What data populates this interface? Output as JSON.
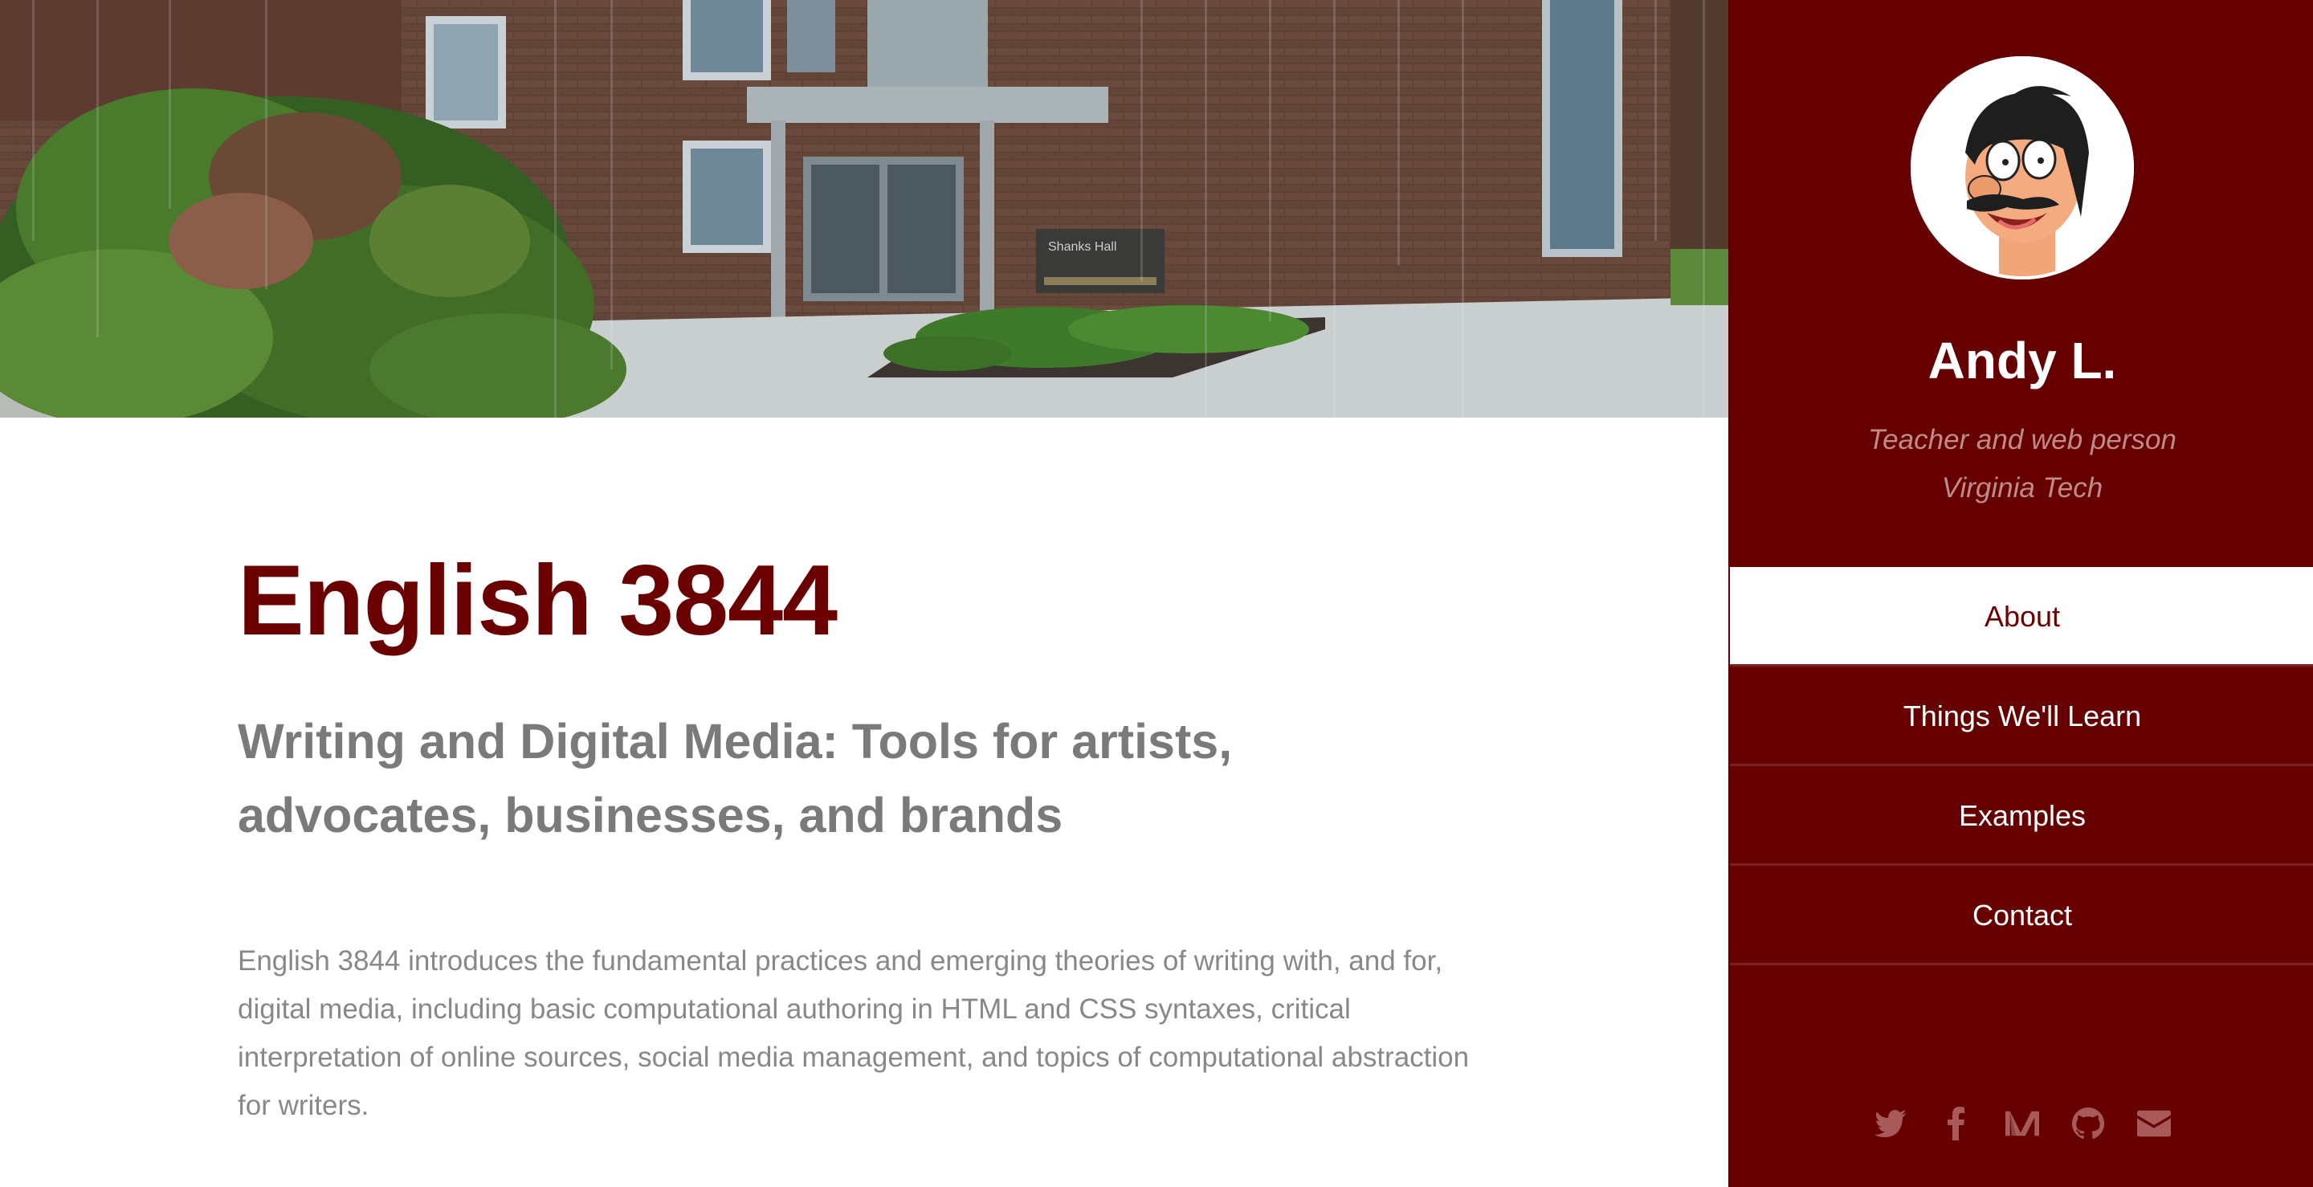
{
  "main": {
    "title": "English 3844",
    "subtitle": "Writing and Digital Media: Tools for artists, advocates, businesses, and brands",
    "description": "English 3844 introduces the fundamental practices and emerging theories of writing with, and for, digital media, including basic computational authoring in HTML and CSS syntaxes, critical interpretation of online sources, social media management, and topics of computational abstraction for writers.",
    "hero_sign_text": "Shanks Hall"
  },
  "sidebar": {
    "name": "Andy L.",
    "role": "Teacher and web person",
    "organization": "Virginia Tech",
    "nav": [
      {
        "label": "About",
        "active": true
      },
      {
        "label": "Things We'll Learn",
        "active": false
      },
      {
        "label": "Examples",
        "active": false
      },
      {
        "label": "Contact",
        "active": false
      }
    ],
    "social": [
      "twitter-icon",
      "facebook-icon",
      "medium-icon",
      "github-icon",
      "email-icon"
    ]
  },
  "colors": {
    "maroon": "#660000",
    "title": "#6b0000",
    "subtitle_gray": "#7a7a7a",
    "body_gray": "#888888",
    "social_icon": "#a85a5a"
  }
}
